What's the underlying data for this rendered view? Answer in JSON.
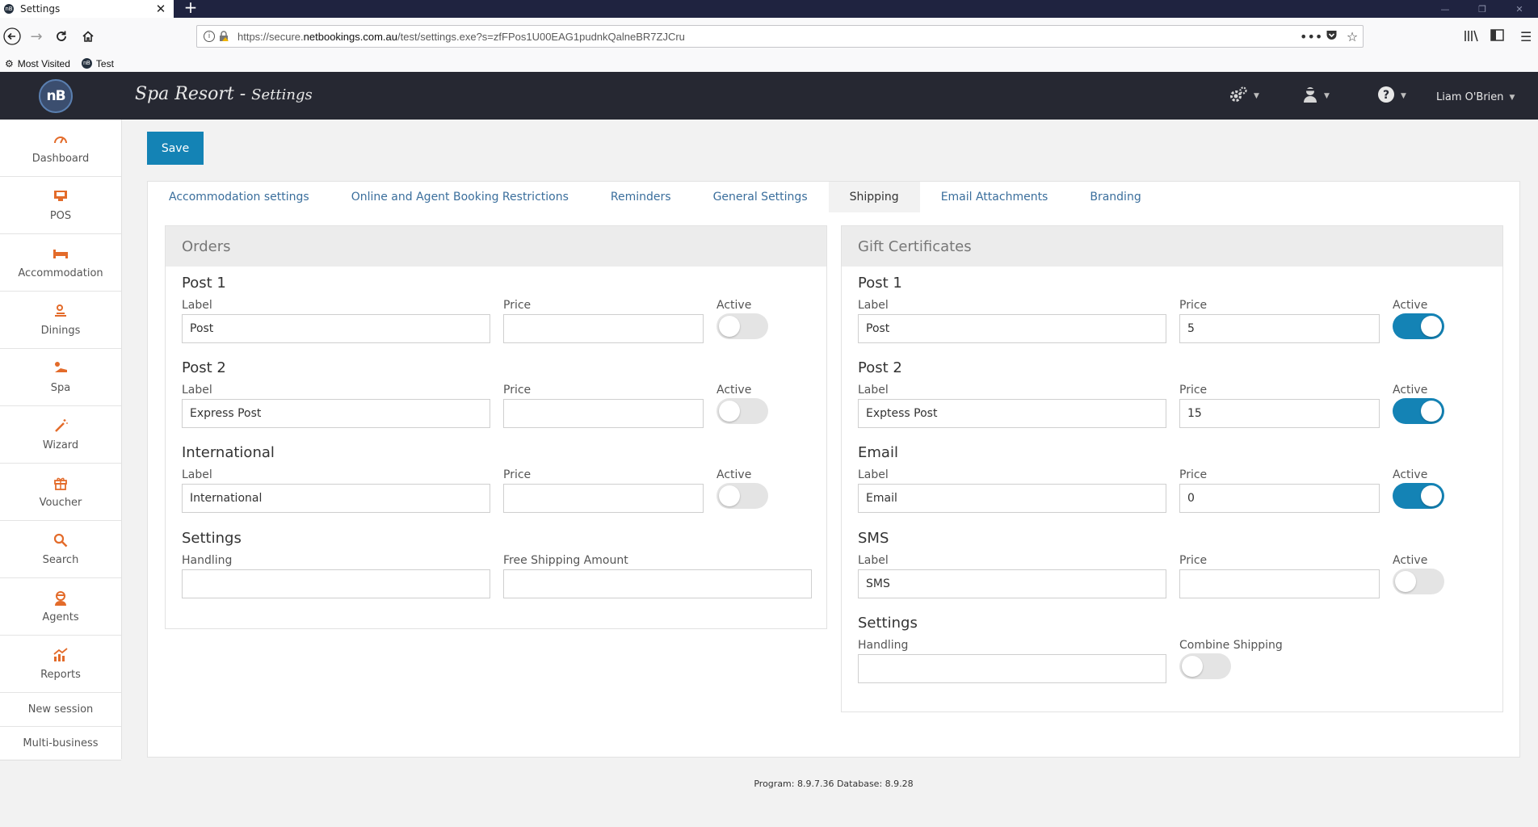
{
  "browser": {
    "tab_title": "Settings",
    "url_prefix": "https://secure.",
    "url_domain": "netbookings.com.au",
    "url_path": "/test/settings.exe?s=zfFPos1U00EAG1pudnkQalneBR7ZJCru",
    "bookmarks": [
      {
        "label": "Most Visited",
        "icon": "gear-icon"
      },
      {
        "label": "Test",
        "icon": "nb-favicon"
      }
    ]
  },
  "header": {
    "logo": "nB",
    "title_main": "Spa Resort",
    "title_sep": " - ",
    "title_sub": "Settings",
    "user_name": "Liam O'Brien"
  },
  "sidebar": {
    "items": [
      {
        "label": "Dashboard",
        "icon": "dashboard-icon"
      },
      {
        "label": "POS",
        "icon": "pos-icon"
      },
      {
        "label": "Accommodation",
        "icon": "bed-icon"
      },
      {
        "label": "Dinings",
        "icon": "dining-icon"
      },
      {
        "label": "Spa",
        "icon": "spa-icon"
      },
      {
        "label": "Wizard",
        "icon": "wand-icon"
      },
      {
        "label": "Voucher",
        "icon": "gift-icon"
      },
      {
        "label": "Search",
        "icon": "search-icon"
      },
      {
        "label": "Agents",
        "icon": "agent-icon"
      },
      {
        "label": "Reports",
        "icon": "chart-icon"
      }
    ],
    "new_session": "New session",
    "multi_business": "Multi-business"
  },
  "toolbar": {
    "save_label": "Save"
  },
  "tabs": [
    {
      "label": "Accommodation settings",
      "active": false
    },
    {
      "label": "Online and Agent Booking Restrictions",
      "active": false
    },
    {
      "label": "Reminders",
      "active": false
    },
    {
      "label": "General Settings",
      "active": false
    },
    {
      "label": "Shipping",
      "active": true
    },
    {
      "label": "Email Attachments",
      "active": false
    },
    {
      "label": "Branding",
      "active": false
    }
  ],
  "orders": {
    "title": "Orders",
    "post1": {
      "title": "Post 1",
      "label_caption": "Label",
      "price_caption": "Price",
      "active_caption": "Active",
      "label_value": "Post",
      "price_value": "",
      "active": false
    },
    "post2": {
      "title": "Post 2",
      "label_caption": "Label",
      "price_caption": "Price",
      "active_caption": "Active",
      "label_value": "Express Post",
      "price_value": "",
      "active": false
    },
    "international": {
      "title": "International",
      "label_caption": "Label",
      "price_caption": "Price",
      "active_caption": "Active",
      "label_value": "International",
      "price_value": "",
      "active": false
    },
    "settings": {
      "title": "Settings",
      "handling_caption": "Handling",
      "handling_value": "",
      "free_caption": "Free Shipping Amount",
      "free_value": ""
    }
  },
  "gift": {
    "title": "Gift Certificates",
    "post1": {
      "title": "Post 1",
      "label_caption": "Label",
      "price_caption": "Price",
      "active_caption": "Active",
      "label_value": "Post",
      "price_value": "5",
      "active": true
    },
    "post2": {
      "title": "Post 2",
      "label_caption": "Label",
      "price_caption": "Price",
      "active_caption": "Active",
      "label_value": "Exptess Post",
      "price_value": "15",
      "active": true
    },
    "email": {
      "title": "Email",
      "label_caption": "Label",
      "price_caption": "Price",
      "active_caption": "Active",
      "label_value": "Email",
      "price_value": "0",
      "active": true
    },
    "sms": {
      "title": "SMS",
      "label_caption": "Label",
      "price_caption": "Price",
      "active_caption": "Active",
      "label_value": "SMS",
      "price_value": "",
      "active": false
    },
    "settings": {
      "title": "Settings",
      "handling_caption": "Handling",
      "handling_value": "",
      "combine_caption": "Combine Shipping",
      "combine_active": false
    }
  },
  "footer": {
    "version": "Program: 8.9.7.36 Database: 8.9.28"
  },
  "colors": {
    "accent": "#1483b5",
    "header_bg": "#262832",
    "icon_orange": "#e36b2a"
  }
}
